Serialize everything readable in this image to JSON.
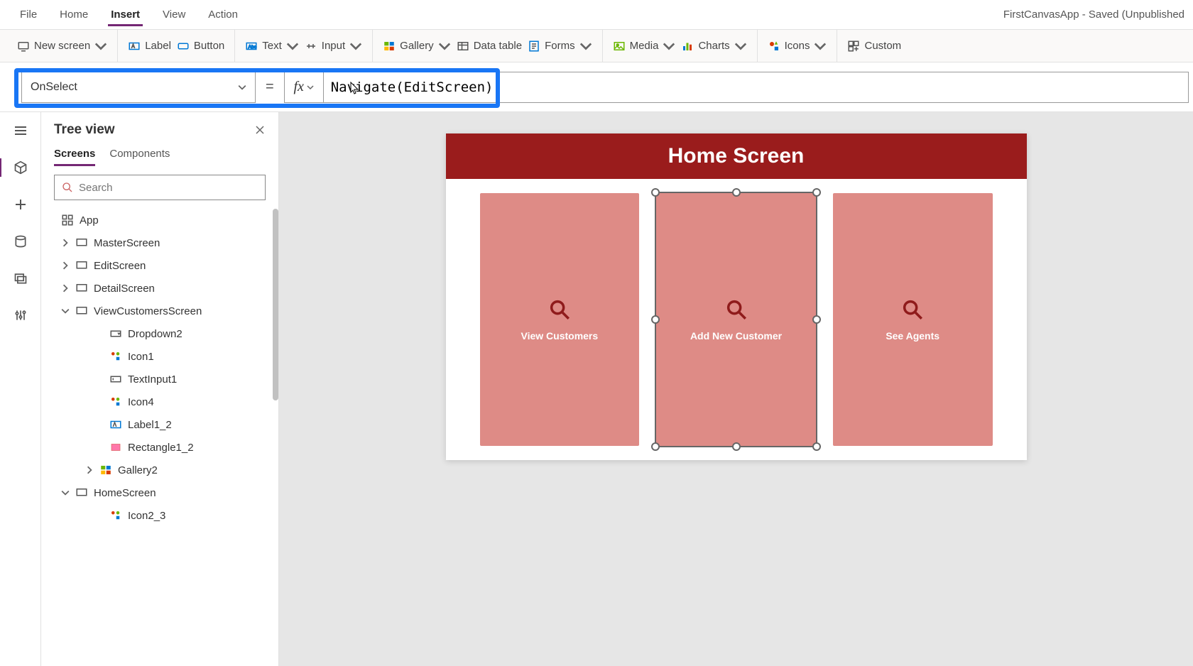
{
  "menu": {
    "file": "File",
    "home": "Home",
    "insert": "Insert",
    "view": "View",
    "action": "Action",
    "active": "Insert",
    "app_title": "FirstCanvasApp - Saved (Unpublished"
  },
  "ribbon": {
    "new_screen": "New screen",
    "label": "Label",
    "button": "Button",
    "text": "Text",
    "input": "Input",
    "gallery": "Gallery",
    "data_table": "Data table",
    "forms": "Forms",
    "media": "Media",
    "charts": "Charts",
    "icons": "Icons",
    "custom": "Custom"
  },
  "formula": {
    "property": "OnSelect",
    "value": "Navigate(EditScreen)"
  },
  "panel": {
    "title": "Tree view",
    "tab_screens": "Screens",
    "tab_components": "Components",
    "active_tab": "Screens",
    "search_placeholder": "Search"
  },
  "tree": {
    "app": "App",
    "master": "MasterScreen",
    "edit": "EditScreen",
    "detail": "DetailScreen",
    "viewcust": "ViewCustomersScreen",
    "dropdown2": "Dropdown2",
    "icon1": "Icon1",
    "textinput1": "TextInput1",
    "icon4": "Icon4",
    "label1_2": "Label1_2",
    "rectangle1_2": "Rectangle1_2",
    "gallery2": "Gallery2",
    "homescreen": "HomeScreen",
    "icon2_3": "Icon2_3"
  },
  "canvas": {
    "header": "Home Screen",
    "cards": [
      {
        "label": "View Customers"
      },
      {
        "label": "Add New Customer"
      },
      {
        "label": "See Agents"
      }
    ],
    "selected_card": 1,
    "colors": {
      "header_bg": "#9a1c1c",
      "card_bg": "#de8b86",
      "icon_stroke": "#8f1b1b"
    }
  }
}
